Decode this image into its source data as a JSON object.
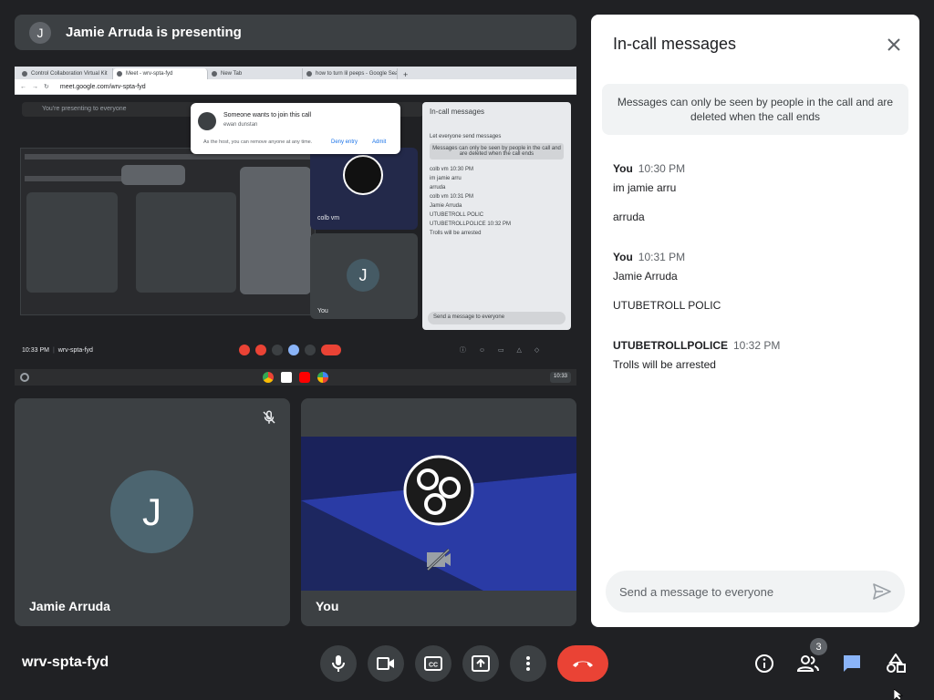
{
  "presenting": {
    "avatar_initial": "J",
    "text": "Jamie Arruda is presenting"
  },
  "shared_screen": {
    "tabs": [
      "Control Collaboration Virtual Kit",
      "Meet - wrv-spta-fyd",
      "New Tab",
      "how to turn lil peeps - Google Sea"
    ],
    "address": "meet.google.com/wrv-spta-fyd",
    "presenting_label": "You're presenting to everyone",
    "notification": {
      "title": "Someone wants to join this call",
      "subtitle": "ewan dunstan",
      "hint": "As the host, you can remove anyone at any time.",
      "deny": "Deny entry",
      "admit": "Admit"
    },
    "tile_name": "colb vm",
    "tile_you": "You",
    "tile_initial": "J",
    "inner_chat": {
      "title": "In-call messages",
      "toggle_label": "Let everyone send messages",
      "info": "Messages can only be seen by people in the call and are deleted when the call ends",
      "lines": [
        "colb vm  10:30 PM",
        "im jamie arru",
        "arruda",
        "colb vm  10:31 PM",
        "Jamie Arruda",
        "UTUBETROLL POLIC",
        "UTUBETROLLPOLICE  10:32 PM",
        "Trolls will be arrested"
      ],
      "input_placeholder": "Send a message to everyone"
    },
    "inner_bar": {
      "time": "10:33 PM",
      "code": "wrv-spta-fyd",
      "badge": "3"
    },
    "clock": "10:33"
  },
  "tiles": {
    "jamie": {
      "initial": "J",
      "name": "Jamie Arruda"
    },
    "you": {
      "name": "You"
    }
  },
  "chat": {
    "title": "In-call messages",
    "info": "Messages can only be seen by people in the call and are deleted when the call ends",
    "groups": [
      {
        "sender": "You",
        "time": "10:30 PM",
        "messages": [
          "im jamie arru",
          "arruda"
        ]
      },
      {
        "sender": "You",
        "time": "10:31 PM",
        "messages": [
          "Jamie Arruda",
          "UTUBETROLL POLIC"
        ]
      },
      {
        "sender": "UTUBETROLLPOLICE",
        "time": "10:32 PM",
        "messages": [
          "Trolls will be arrested"
        ]
      }
    ],
    "input_placeholder": "Send a message to everyone"
  },
  "bottom": {
    "meeting_code": "wrv-spta-fyd",
    "participants_badge": "3",
    "icons": [
      "microphone-icon",
      "camera-icon",
      "captions-icon",
      "present-icon",
      "more-options-icon",
      "end-call-icon",
      "info-icon",
      "people-icon",
      "chat-icon",
      "activities-icon"
    ]
  },
  "colors": {
    "background": "#202124",
    "tile": "#3c4043",
    "end_call": "#ea4335",
    "chat_accent": "#1a73e8",
    "avatar": "#4c6570"
  }
}
